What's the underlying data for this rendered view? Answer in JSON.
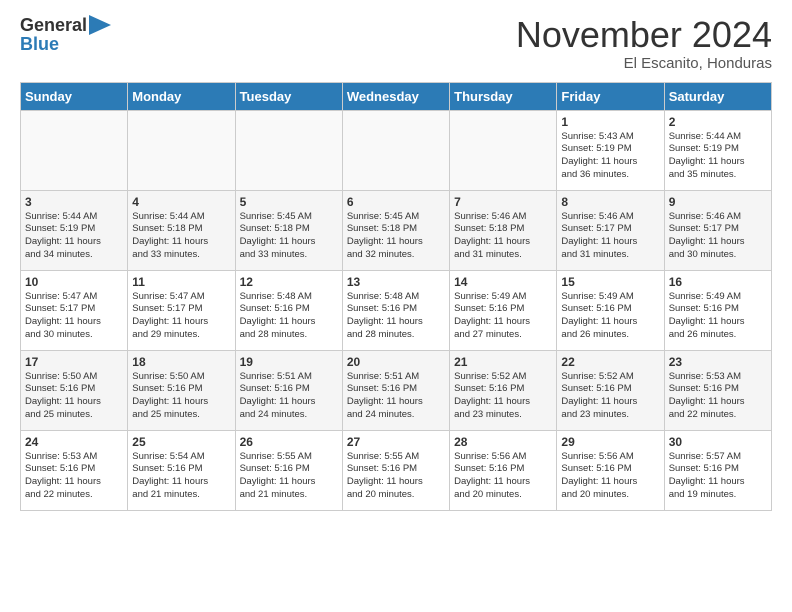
{
  "header": {
    "logo_general": "General",
    "logo_blue": "Blue",
    "month_title": "November 2024",
    "location": "El Escanito, Honduras"
  },
  "weekdays": [
    "Sunday",
    "Monday",
    "Tuesday",
    "Wednesday",
    "Thursday",
    "Friday",
    "Saturday"
  ],
  "weeks": [
    [
      {
        "day": "",
        "info": ""
      },
      {
        "day": "",
        "info": ""
      },
      {
        "day": "",
        "info": ""
      },
      {
        "day": "",
        "info": ""
      },
      {
        "day": "",
        "info": ""
      },
      {
        "day": "1",
        "info": "Sunrise: 5:43 AM\nSunset: 5:19 PM\nDaylight: 11 hours\nand 36 minutes."
      },
      {
        "day": "2",
        "info": "Sunrise: 5:44 AM\nSunset: 5:19 PM\nDaylight: 11 hours\nand 35 minutes."
      }
    ],
    [
      {
        "day": "3",
        "info": "Sunrise: 5:44 AM\nSunset: 5:19 PM\nDaylight: 11 hours\nand 34 minutes."
      },
      {
        "day": "4",
        "info": "Sunrise: 5:44 AM\nSunset: 5:18 PM\nDaylight: 11 hours\nand 33 minutes."
      },
      {
        "day": "5",
        "info": "Sunrise: 5:45 AM\nSunset: 5:18 PM\nDaylight: 11 hours\nand 33 minutes."
      },
      {
        "day": "6",
        "info": "Sunrise: 5:45 AM\nSunset: 5:18 PM\nDaylight: 11 hours\nand 32 minutes."
      },
      {
        "day": "7",
        "info": "Sunrise: 5:46 AM\nSunset: 5:18 PM\nDaylight: 11 hours\nand 31 minutes."
      },
      {
        "day": "8",
        "info": "Sunrise: 5:46 AM\nSunset: 5:17 PM\nDaylight: 11 hours\nand 31 minutes."
      },
      {
        "day": "9",
        "info": "Sunrise: 5:46 AM\nSunset: 5:17 PM\nDaylight: 11 hours\nand 30 minutes."
      }
    ],
    [
      {
        "day": "10",
        "info": "Sunrise: 5:47 AM\nSunset: 5:17 PM\nDaylight: 11 hours\nand 30 minutes."
      },
      {
        "day": "11",
        "info": "Sunrise: 5:47 AM\nSunset: 5:17 PM\nDaylight: 11 hours\nand 29 minutes."
      },
      {
        "day": "12",
        "info": "Sunrise: 5:48 AM\nSunset: 5:16 PM\nDaylight: 11 hours\nand 28 minutes."
      },
      {
        "day": "13",
        "info": "Sunrise: 5:48 AM\nSunset: 5:16 PM\nDaylight: 11 hours\nand 28 minutes."
      },
      {
        "day": "14",
        "info": "Sunrise: 5:49 AM\nSunset: 5:16 PM\nDaylight: 11 hours\nand 27 minutes."
      },
      {
        "day": "15",
        "info": "Sunrise: 5:49 AM\nSunset: 5:16 PM\nDaylight: 11 hours\nand 26 minutes."
      },
      {
        "day": "16",
        "info": "Sunrise: 5:49 AM\nSunset: 5:16 PM\nDaylight: 11 hours\nand 26 minutes."
      }
    ],
    [
      {
        "day": "17",
        "info": "Sunrise: 5:50 AM\nSunset: 5:16 PM\nDaylight: 11 hours\nand 25 minutes."
      },
      {
        "day": "18",
        "info": "Sunrise: 5:50 AM\nSunset: 5:16 PM\nDaylight: 11 hours\nand 25 minutes."
      },
      {
        "day": "19",
        "info": "Sunrise: 5:51 AM\nSunset: 5:16 PM\nDaylight: 11 hours\nand 24 minutes."
      },
      {
        "day": "20",
        "info": "Sunrise: 5:51 AM\nSunset: 5:16 PM\nDaylight: 11 hours\nand 24 minutes."
      },
      {
        "day": "21",
        "info": "Sunrise: 5:52 AM\nSunset: 5:16 PM\nDaylight: 11 hours\nand 23 minutes."
      },
      {
        "day": "22",
        "info": "Sunrise: 5:52 AM\nSunset: 5:16 PM\nDaylight: 11 hours\nand 23 minutes."
      },
      {
        "day": "23",
        "info": "Sunrise: 5:53 AM\nSunset: 5:16 PM\nDaylight: 11 hours\nand 22 minutes."
      }
    ],
    [
      {
        "day": "24",
        "info": "Sunrise: 5:53 AM\nSunset: 5:16 PM\nDaylight: 11 hours\nand 22 minutes."
      },
      {
        "day": "25",
        "info": "Sunrise: 5:54 AM\nSunset: 5:16 PM\nDaylight: 11 hours\nand 21 minutes."
      },
      {
        "day": "26",
        "info": "Sunrise: 5:55 AM\nSunset: 5:16 PM\nDaylight: 11 hours\nand 21 minutes."
      },
      {
        "day": "27",
        "info": "Sunrise: 5:55 AM\nSunset: 5:16 PM\nDaylight: 11 hours\nand 20 minutes."
      },
      {
        "day": "28",
        "info": "Sunrise: 5:56 AM\nSunset: 5:16 PM\nDaylight: 11 hours\nand 20 minutes."
      },
      {
        "day": "29",
        "info": "Sunrise: 5:56 AM\nSunset: 5:16 PM\nDaylight: 11 hours\nand 20 minutes."
      },
      {
        "day": "30",
        "info": "Sunrise: 5:57 AM\nSunset: 5:16 PM\nDaylight: 11 hours\nand 19 minutes."
      }
    ]
  ]
}
